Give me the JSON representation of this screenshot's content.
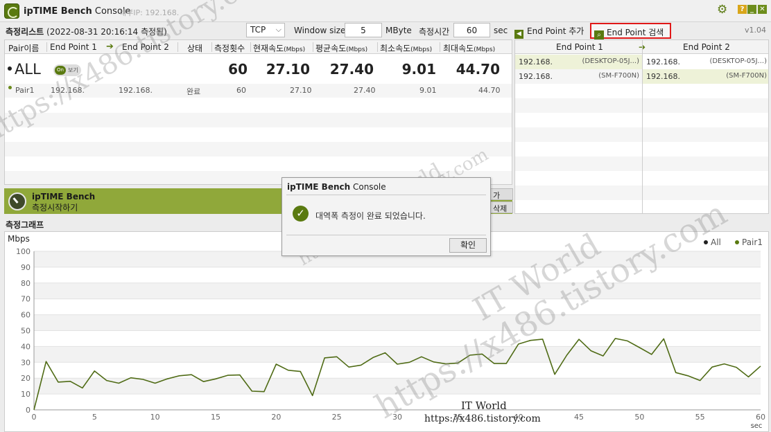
{
  "title_bar": {
    "app_name": "ipTIME Bench",
    "app_suffix": "Console",
    "internal_ip": "내부IP: 192.168.",
    "help_label": "?",
    "minimize_label": "_",
    "close_label": "✕"
  },
  "toolbar": {
    "list_title": "측정리스트",
    "list_subtitle": "(2022-08-31 20:16:14 측정됨)",
    "protocol": "TCP",
    "window_size_label": "Window size",
    "window_size_value": "5",
    "window_size_unit": "MByte",
    "duration_label": "측정시간",
    "duration_value": "60",
    "duration_unit": "sec",
    "add_endpoint": "End Point 추가",
    "search_endpoint": "End Point 검색",
    "version": "v1.04"
  },
  "pair_table": {
    "headers": {
      "pair": "Pair이름",
      "ep1": "End Point 1",
      "ep2": "End Point 2",
      "status": "상태",
      "count": "측정횟수",
      "current": "현재속도",
      "avg": "평균속도",
      "min": "최소속도",
      "max": "최대속도",
      "unit": "(Mbps)"
    },
    "all_row": {
      "label": "ALL",
      "toggle_on": "On",
      "toggle_label": "보기",
      "count": "60",
      "current": "27.10",
      "avg": "27.40",
      "min": "9.01",
      "max": "44.70"
    },
    "pair_row": {
      "name": "Pair1",
      "ep1": "192.168.",
      "ep2": "192.168.",
      "status": "완료",
      "count": "60",
      "current": "27.10",
      "avg": "27.40",
      "min": "9.01",
      "max": "44.70"
    }
  },
  "endpoint_table": {
    "header_ep1": "End Point 1",
    "header_ep2": "End Point 2",
    "rows": [
      {
        "ep1_ip": "192.168.",
        "ep1_name": "(DESKTOP-05J...)",
        "ep2_ip": "192.168.",
        "ep2_name": "(DESKTOP-05J...)"
      },
      {
        "ep1_ip": "192.168.",
        "ep1_name": "(SM-F700N)",
        "ep2_ip": "192.168.",
        "ep2_name": "(SM-F700N)"
      }
    ]
  },
  "bench_bar": {
    "title": "ipTIME Bench",
    "subtitle": "측정시작하기",
    "side_btn_1": "가",
    "side_btn_2": "삭제"
  },
  "graph": {
    "title": "측정그래프",
    "unit": "Mbps",
    "legend_all": "All",
    "legend_pair": "Pair1",
    "line_color": "#4f6b15",
    "x_unit": "sec"
  },
  "chart_data": {
    "type": "line",
    "ylabel": "Mbps",
    "xlabel": "sec",
    "ylim": [
      0,
      100
    ],
    "xlim": [
      0,
      60
    ],
    "yticks": [
      0,
      10,
      20,
      30,
      40,
      50,
      60,
      70,
      80,
      90,
      100
    ],
    "xticks": [
      0,
      5,
      10,
      15,
      20,
      25,
      30,
      35,
      40,
      45,
      50,
      55,
      60
    ],
    "series": [
      {
        "name": "Pair1",
        "x": [
          0,
          1,
          2,
          3,
          4,
          5,
          6,
          7,
          8,
          9,
          10,
          11,
          12,
          13,
          14,
          15,
          16,
          17,
          18,
          19,
          20,
          21,
          22,
          23,
          24,
          25,
          26,
          27,
          28,
          29,
          30,
          31,
          32,
          33,
          34,
          35,
          36,
          37,
          38,
          39,
          40,
          41,
          42,
          43,
          44,
          45,
          46,
          47,
          48,
          49,
          50,
          51,
          52,
          53,
          54,
          55,
          56,
          57,
          58,
          59,
          60
        ],
        "y": [
          0,
          30.5,
          17.5,
          18,
          13.8,
          24.5,
          18.5,
          16.8,
          20.2,
          19.2,
          16.8,
          19.5,
          21.5,
          22.2,
          17.8,
          19.5,
          21.8,
          22,
          11.8,
          11.5,
          28.8,
          25,
          24.2,
          9,
          32.8,
          33.5,
          27,
          28.2,
          33,
          36,
          28.8,
          30,
          33.5,
          30.2,
          29,
          29.5,
          34.5,
          35.2,
          29.2,
          29.2,
          41.5,
          43.8,
          44.6,
          22.4,
          34.5,
          44.5,
          37.2,
          34,
          45,
          43.5,
          39.3,
          35,
          44.8,
          23.5,
          21.5,
          18.5,
          27,
          29,
          26.8,
          20.8,
          27.6
        ]
      }
    ]
  },
  "watermark": {
    "site": "IT World",
    "url": "https://x486.tistory.com"
  },
  "dialog": {
    "title_bold": "ipTIME Bench",
    "title_rest": "Console",
    "message": "대역폭 측정이 완료 되었습니다.",
    "ok_label": "확인"
  }
}
